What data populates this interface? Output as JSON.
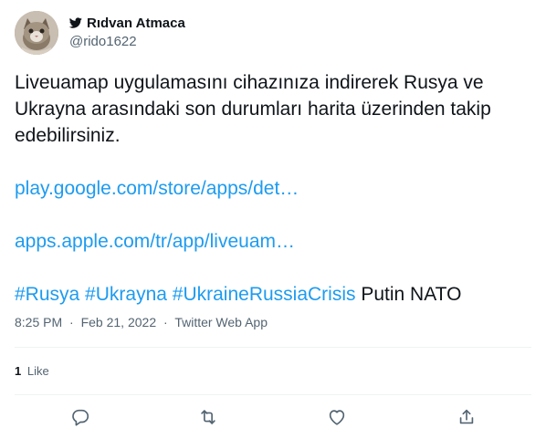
{
  "author": {
    "display_name": "Rıdvan Atmaca",
    "handle": "@rido1622",
    "avatar_icon": "cat-avatar",
    "platform_icon": "twitter-bird-icon"
  },
  "tweet": {
    "text_line": "Liveuamap uygulamasını cihazınıza indirerek Rusya ve Ukrayna arasındaki son durumları harita üzerinden takip edebilirsiniz.",
    "link_1": "play.google.com/store/apps/det…",
    "link_2": "apps.apple.com/tr/app/liveuam…",
    "hashtags": [
      "#Rusya",
      "#Ukrayna",
      "#UkraineRussiaCrisis"
    ],
    "trailing_text": "Putin NATO"
  },
  "meta": {
    "time": "8:25 PM",
    "separator": "·",
    "date": "Feb 21, 2022",
    "source": "Twitter Web App"
  },
  "engagement": {
    "like_count": "1",
    "like_label": "Like"
  },
  "actions": [
    "reply-icon",
    "retweet-icon",
    "like-icon",
    "share-icon"
  ],
  "colors": {
    "link": "#1d9bf0",
    "text": "#0f1419",
    "secondary": "#536471",
    "twitter_blue": "#1d9bf0"
  }
}
